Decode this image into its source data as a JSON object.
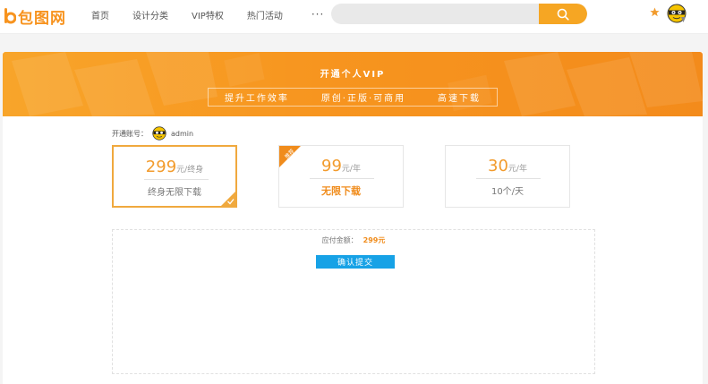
{
  "brand": {
    "name": "包图网",
    "accent": "#f7931e"
  },
  "nav": {
    "items": [
      "首页",
      "设计分类",
      "VIP特权",
      "热门活动"
    ],
    "more": "···"
  },
  "search": {
    "placeholder": "",
    "icon": "search-icon"
  },
  "banner": {
    "title": "开通个人VIP",
    "features": [
      "提升工作效率",
      "原创·正版·可商用",
      "高速下载"
    ]
  },
  "account": {
    "label": "开通账号：",
    "username": "admin"
  },
  "plans": [
    {
      "price": "299",
      "unit": "元/终身",
      "desc": "终身无限下载",
      "selected": true
    },
    {
      "price": "99",
      "unit": "元/年",
      "desc": "无限下载",
      "badge": "推荐"
    },
    {
      "price": "30",
      "unit": "元/年",
      "desc": "10个/天"
    }
  ],
  "payment": {
    "label": "应付金额：",
    "amount": "299元",
    "confirm": "确认提交"
  },
  "colors": {
    "orange": "#f6a623",
    "blue": "#17a2e6",
    "price": "#f29b2c"
  }
}
